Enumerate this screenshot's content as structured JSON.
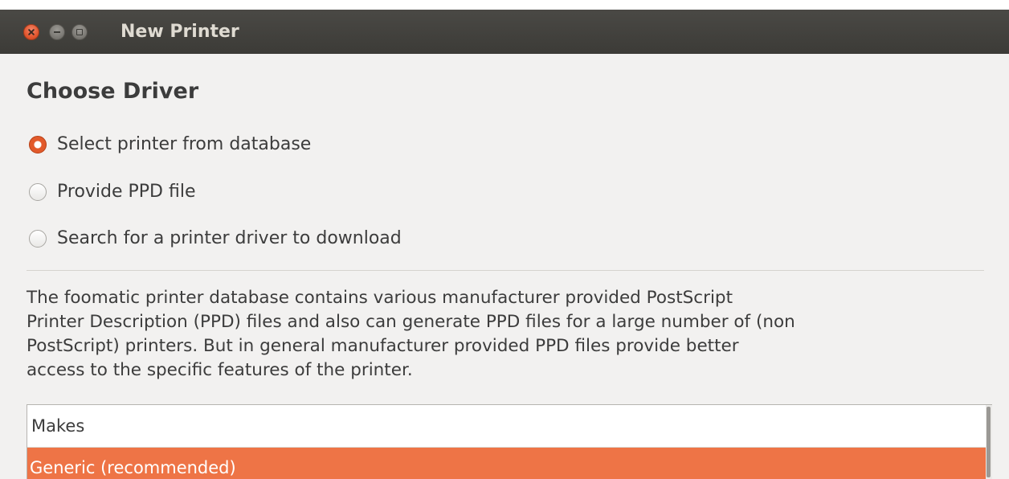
{
  "window": {
    "title": "New Printer",
    "controls": {
      "close": "close-icon",
      "minimize": "minimize-icon",
      "maximize": "maximize-icon"
    }
  },
  "page": {
    "heading": "Choose Driver"
  },
  "driver_options": [
    {
      "label": "Select printer from database",
      "checked": true
    },
    {
      "label": "Provide PPD file",
      "checked": false
    },
    {
      "label": "Search for a printer driver to download",
      "checked": false
    }
  ],
  "description": {
    "lines": [
      "The foomatic printer database contains various manufacturer provided PostScript",
      "Printer Description (PPD) files and also can generate PPD files for a large number of (non",
      "PostScript) printers. But in general manufacturer provided PPD files provide better",
      "access to the specific features of the printer."
    ]
  },
  "makes_list": {
    "header": "Makes",
    "items": [
      {
        "label": "Generic (recommended)",
        "selected": true
      }
    ]
  },
  "colors": {
    "accent": "#e25a2b",
    "selection": "#ee7446",
    "titlebar": "#3c3b37",
    "background": "#f2f1f0"
  }
}
